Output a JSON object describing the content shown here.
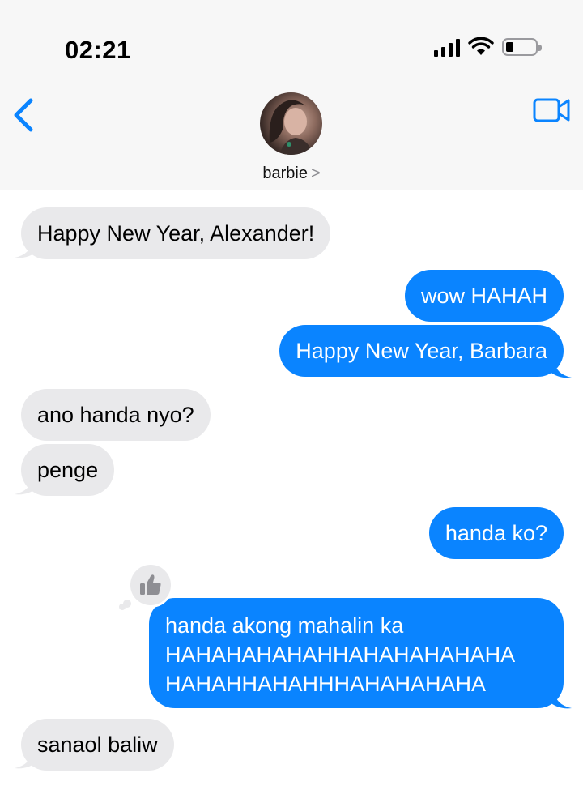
{
  "status_bar": {
    "time": "02:21"
  },
  "conversation": {
    "contact_name": "barbie",
    "contact_chevron": ">"
  },
  "messages": [
    {
      "from": "received",
      "text": "Happy New Year, Alexander!"
    },
    {
      "from": "sent",
      "text": "wow HAHAH"
    },
    {
      "from": "sent",
      "text": "Happy New Year, Barbara"
    },
    {
      "from": "received",
      "text": "ano handa nyo?"
    },
    {
      "from": "received",
      "text": "penge"
    },
    {
      "from": "sent",
      "text": "handa ko?"
    },
    {
      "from": "sent",
      "text": "handa akong mahalin ka\nHAHAHAHAHAHHAHAHAHAHAHA\nHAHAHHAHAHHHAHAHAHAHA",
      "reaction": "thumbs-up"
    },
    {
      "from": "received",
      "text": "sanaol baliw"
    }
  ],
  "colors": {
    "sent_bubble": "#0a84ff",
    "received_bubble": "#e9e9eb",
    "accent": "#0a84ff"
  },
  "icons": {
    "back": "chevron-left-icon",
    "video": "video-camera-icon",
    "signal": "cellular-signal-icon",
    "wifi": "wifi-icon",
    "battery": "battery-icon",
    "reaction": "thumbs-up-icon"
  },
  "battery_level": 0.2
}
